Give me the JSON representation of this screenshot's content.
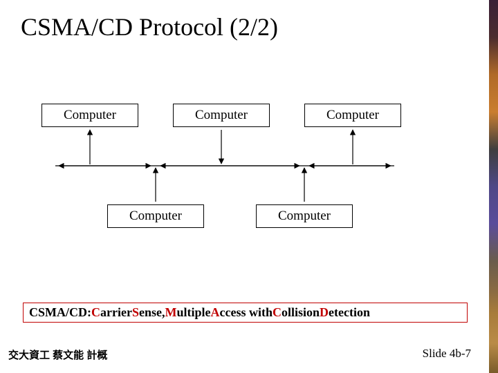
{
  "title": "CSMA/CD Protocol (2/2)",
  "nodes": {
    "top1": "Computer",
    "top2": "Computer",
    "top3": "Computer",
    "bot1": "Computer",
    "bot2": "Computer"
  },
  "definition": {
    "prefix": "CSMA/CD:  ",
    "parts": [
      {
        "hl": "C",
        "rest": "arrier "
      },
      {
        "hl": "S",
        "rest": "ense, "
      },
      {
        "hl": "M",
        "rest": "ultiple "
      },
      {
        "hl": "A",
        "rest": "ccess with "
      },
      {
        "hl": "C",
        "rest": "ollision "
      },
      {
        "hl": "D",
        "rest": "etection"
      }
    ]
  },
  "footer_left": "交大資工 蔡文能 計概",
  "footer_right": "Slide 4b-7"
}
